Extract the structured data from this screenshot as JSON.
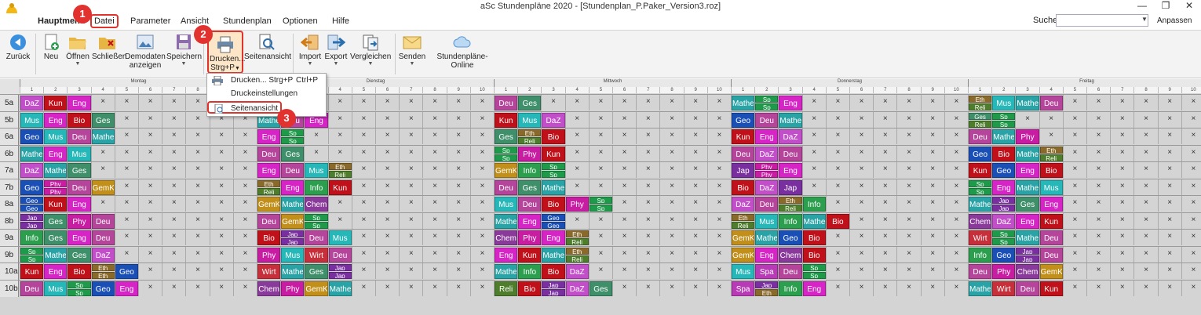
{
  "window": {
    "title": "aSc Stundenpläne 2020  -  [Stundenplan_P.Paker_Version3.roz]"
  },
  "menu": {
    "home": "Hauptmenü",
    "datei": "Datei",
    "parameter": "Parameter",
    "ansicht": "Ansicht",
    "stundenplan": "Stundenplan",
    "optionen": "Optionen",
    "hilfe": "Hilfe",
    "search_label": "Suche:",
    "search_value": "",
    "customize": "Anpassen"
  },
  "ribbon": {
    "zurueck": "Zurück",
    "neu": "Neu",
    "oeffnen": "Öffnen",
    "schliessen": "Schließen",
    "demodaten_1": "Demodaten",
    "demodaten_2": "anzeigen",
    "speichern": "Speichern",
    "drucken_1": "Drucken...",
    "drucken_2": "Strg+P",
    "seitenansicht": "Seitenansicht",
    "import": "Import",
    "export": "Export",
    "vergleichen": "Vergleichen",
    "senden": "Senden",
    "online": "Stundenpläne-Online"
  },
  "dropdown": {
    "items": [
      {
        "label": "Drucken... Strg+P",
        "shortcut": "Ctrl+P"
      },
      {
        "label": "Druckeinstellungen",
        "shortcut": ""
      },
      {
        "label": "Seitenansicht",
        "shortcut": ""
      }
    ]
  },
  "callouts": [
    "1",
    "2",
    "3"
  ],
  "days": [
    "Montag",
    "Dienstag",
    "Mittwoch",
    "Donnerstag",
    "Freitag"
  ],
  "periods": [
    "1",
    "2",
    "3",
    "4",
    "5",
    "6",
    "7",
    "8",
    "9",
    "10"
  ],
  "classes": [
    "5a",
    "5b",
    "6a",
    "6b",
    "7a",
    "7b",
    "8a",
    "8b",
    "9a",
    "9b",
    "10a",
    "10b"
  ],
  "colors": {
    "red_annotation": "#e0332b",
    "ribbon_bg": "#f3f3f3",
    "grid_bg": "#d4d4d4"
  },
  "subjects": {
    "DaZ": "#c24fc9",
    "Kun": "#c0101a",
    "Eng": "#d624c6",
    "Mus": "#26b7b8",
    "Bio": "#c0101a",
    "Ges": "#3f8f6a",
    "Geo": "#1a4fb6",
    "Deu": "#b5449b",
    "Mathe": "#2aa3a6",
    "Phy": "#c81ca3",
    "Info": "#2c9f4f",
    "Sp": "#1f9a4b",
    "GemK": "#c2901a",
    "Jap": "#7a2fa0",
    "Eth": "#8a6a2b",
    "Reli": "#4e7e2c",
    "Spa": "#b93ab6",
    "Chem": "#8a3a9a",
    "Wirt": "#c7303b"
  },
  "timetable": {
    "5a": [
      [
        "DaZ",
        "Kun",
        "Eng"
      ],
      [
        "Geo",
        "Mus"
      ],
      [
        "Deu",
        "Ges"
      ],
      [
        "Mathe",
        "Sp/Sp",
        "Eng"
      ],
      [
        "Eth/Reli",
        "Mus",
        "Mathe",
        "Deu"
      ]
    ],
    "5b": [
      [
        "Mus",
        "Eng",
        "Bio",
        "Ges"
      ],
      [
        "Mathe",
        "Deu",
        "Eng"
      ],
      [
        "Kun",
        "Mus",
        "DaZ"
      ],
      [
        "Geo",
        "Deu",
        "Mathe"
      ],
      [
        "Ges/Reli",
        "Sp/Sp"
      ]
    ],
    "6a": [
      [
        "Geo",
        "Mus",
        "Deu",
        "Mathe"
      ],
      [
        "Eng",
        "Sp/Sp"
      ],
      [
        "Ges",
        "Eth/Reli",
        "Bio"
      ],
      [
        "Kun",
        "Eng",
        "DaZ"
      ],
      [
        "Deu",
        "Mathe",
        "Phy"
      ]
    ],
    "6b": [
      [
        "Mathe",
        "Eng",
        "Mus"
      ],
      [
        "Deu",
        "Ges"
      ],
      [
        "Sp/Sp",
        "Phy",
        "Kun"
      ],
      [
        "Deu",
        "DaZ",
        "Deu"
      ],
      [
        "Geo",
        "Bio",
        "Mathe",
        "Eth/Reli"
      ]
    ],
    "7a": [
      [
        "DaZ",
        "Mathe",
        "Ges"
      ],
      [
        "Eng",
        "Deu",
        "Mus",
        "Eth/Reli"
      ],
      [
        "GemK",
        "Info",
        "Sp/Sp"
      ],
      [
        "Jap",
        "Phy/Phy",
        "Eng"
      ],
      [
        "Kun",
        "Geo",
        "Eng",
        "Bio"
      ]
    ],
    "7b": [
      [
        "Geo",
        "Phy/Phy",
        "Deu",
        "GemK"
      ],
      [
        "Eth/Reli",
        "Eng",
        "Info",
        "Kun"
      ],
      [
        "Deu",
        "Ges",
        "Mathe"
      ],
      [
        "Bio",
        "DaZ",
        "Jap"
      ],
      [
        "Sp/Sp",
        "Eng",
        "Mathe",
        "Mus"
      ]
    ],
    "8a": [
      [
        "Geo/Geo",
        "Kun",
        "Eng"
      ],
      [
        "GemK",
        "Mathe",
        "Chem"
      ],
      [
        "Mus",
        "Deu",
        "Bio",
        "Phy",
        "Sp/Sp"
      ],
      [
        "DaZ",
        "Deu",
        "Eth/Reli",
        "Info"
      ],
      [
        "Mathe",
        "Jap/Jap",
        "Ges",
        "Eng"
      ]
    ],
    "8b": [
      [
        "Jap/Jap",
        "Ges",
        "Phy",
        "Deu"
      ],
      [
        "Deu",
        "GemK",
        "Sp/Sp"
      ],
      [
        "Mathe",
        "Eng",
        "Geo/Geo"
      ],
      [
        "Eth/Reli",
        "Mus",
        "Info",
        "Mathe",
        "Bio"
      ],
      [
        "Chem",
        "DaZ",
        "Eng",
        "Kun"
      ]
    ],
    "9a": [
      [
        "Info",
        "Ges",
        "Eng",
        "Deu"
      ],
      [
        "Bio",
        "Jap/Jap",
        "Deu",
        "Mus"
      ],
      [
        "Chem",
        "Phy",
        "Eng",
        "Eth/Reli"
      ],
      [
        "GemK",
        "Mathe",
        "Geo",
        "Bio"
      ],
      [
        "Wirt",
        "Sp/Sp",
        "Mathe",
        "Deu"
      ]
    ],
    "9b": [
      [
        "Sp/Sp",
        "Mathe",
        "Ges",
        "DaZ"
      ],
      [
        "Phy",
        "Mus",
        "Wirt",
        "Deu"
      ],
      [
        "Eng",
        "Kun",
        "Mathe",
        "Eth/Reli"
      ],
      [
        "GemK",
        "Eng",
        "Chem",
        "Bio"
      ],
      [
        "Info",
        "Geo",
        "Jap/Jap",
        "Deu"
      ]
    ],
    "10a": [
      [
        "Kun",
        "Eng",
        "Bio",
        "Eth/Eth",
        "Geo"
      ],
      [
        "Wirt",
        "Mathe",
        "Ges",
        "Jap/Jap"
      ],
      [
        "Mathe",
        "Info",
        "Bio",
        "DaZ"
      ],
      [
        "Mus",
        "Spa",
        "Deu",
        "Sp/Sp/Reli"
      ],
      [
        "Deu",
        "Phy",
        "Chem",
        "GemK"
      ]
    ],
    "10b": [
      [
        "Deu",
        "Mus",
        "Sp/Sp",
        "Geo",
        "Eng"
      ],
      [
        "Chem",
        "Phy",
        "GemK",
        "Mathe"
      ],
      [
        "Reli",
        "Bio",
        "Jap/Jap",
        "DaZ",
        "Ges"
      ],
      [
        "Spa",
        "Jap/Eth",
        "Info",
        "Eng"
      ],
      [
        "Mathe",
        "Wirt",
        "Deu",
        "Kun"
      ]
    ]
  }
}
